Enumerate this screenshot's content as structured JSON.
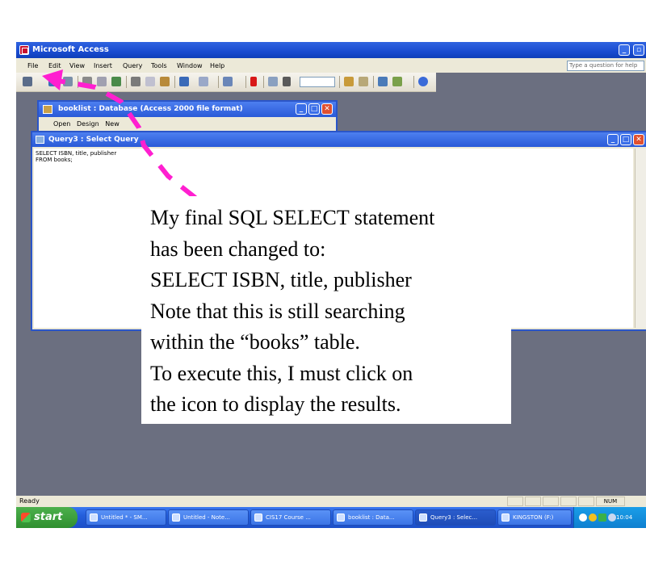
{
  "app": {
    "title": "Microsoft Access",
    "help_placeholder": "Type a question for help"
  },
  "menu": [
    "File",
    "Edit",
    "View",
    "Insert",
    "Query",
    "Tools",
    "Window",
    "Help"
  ],
  "db_window": {
    "title": "booklist : Database (Access 2000 file format)",
    "tools": [
      "Open",
      "Design",
      "New"
    ]
  },
  "query_window": {
    "title": "Query3 : Select Query",
    "sql_line1": "SELECT ISBN, title, publisher",
    "sql_line2": "FROM books;"
  },
  "status": {
    "text": "Ready",
    "num": "NUM"
  },
  "taskbar": {
    "start": "start",
    "tasks": [
      "Untitled * - SM...",
      "Untitled - Note...",
      "CIS17 Course ...",
      "booklist : Data...",
      "Query3 : Selec...",
      "KINGSTON (F:)"
    ],
    "clock": "10:04"
  },
  "annotation": {
    "lines": [
      "My final SQL SELECT statement",
      "has been changed to:",
      "SELECT ISBN, title, publisher",
      "Note that this is still searching",
      "within the “books” table.",
      "To execute this, I must click on",
      "the icon to display the results."
    ]
  },
  "colors": {
    "titlebar": "#1a4cd0",
    "arrow": "#ff1fd0",
    "desktop": "#6b6f80"
  }
}
